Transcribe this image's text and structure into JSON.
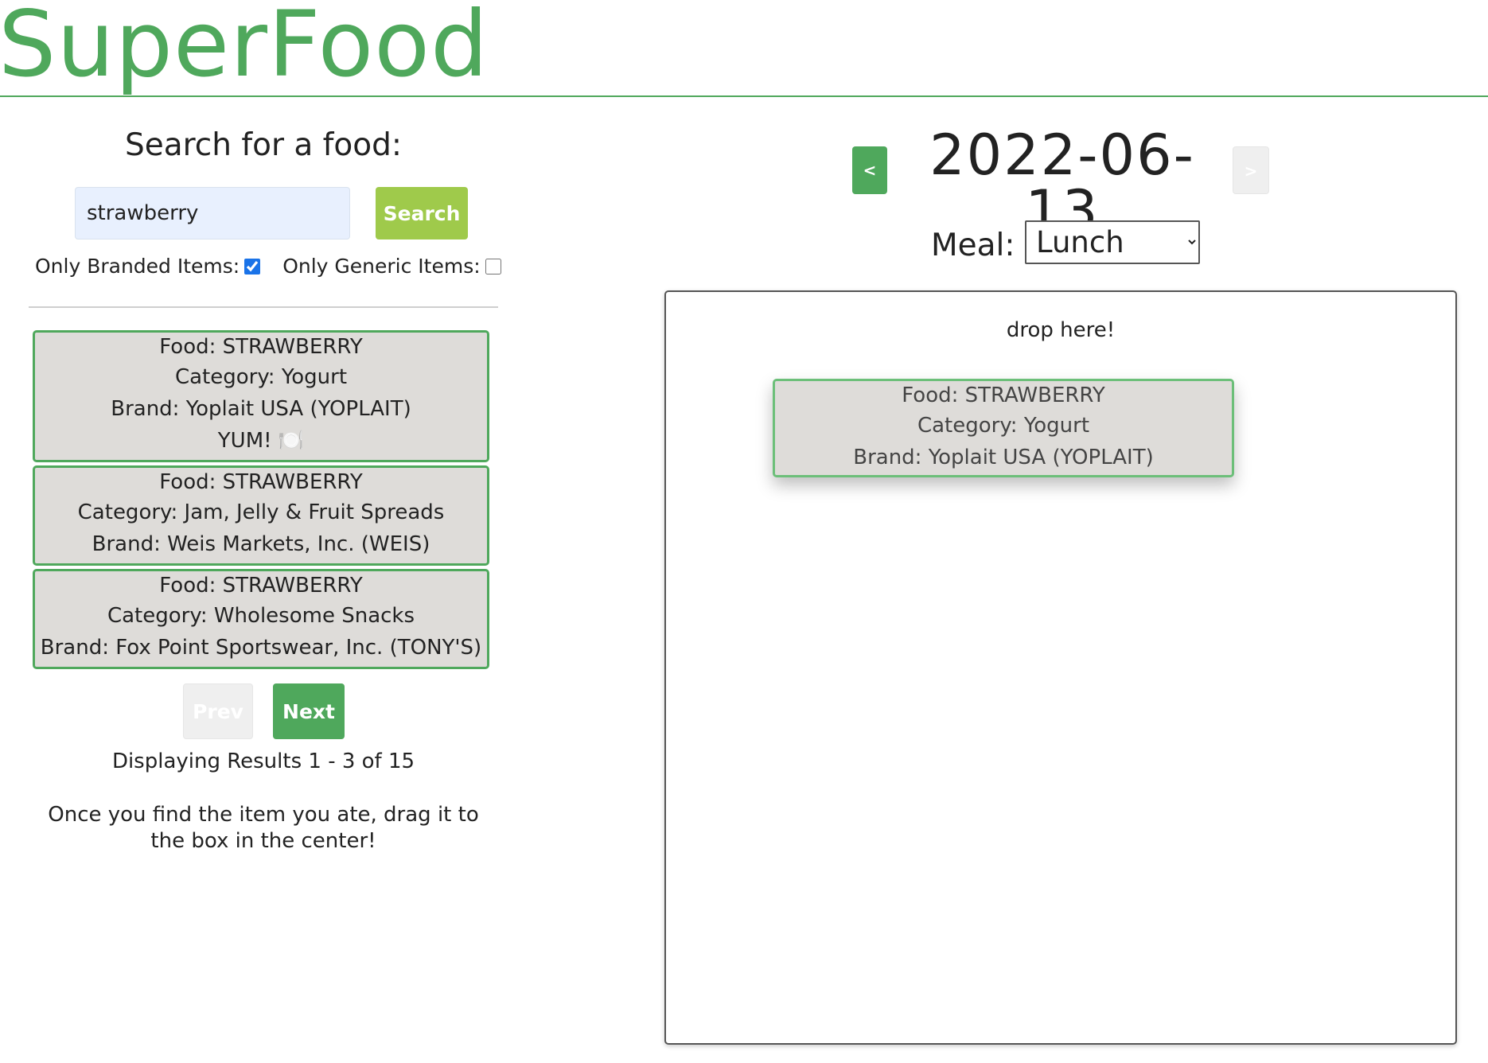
{
  "app": {
    "title": "SuperFood"
  },
  "search": {
    "heading": "Search for a food:",
    "input_value": "strawberry",
    "button_label": "Search",
    "filters": {
      "branded_label": "Only Branded Items:",
      "branded_checked": true,
      "generic_label": "Only Generic Items:",
      "generic_checked": false
    }
  },
  "results": [
    {
      "food": "Food: STRAWBERRY",
      "category": "Category: Yogurt",
      "brand": "Brand: Yoplait USA (YOPLAIT)",
      "note": "YUM! 🍽️"
    },
    {
      "food": "Food: STRAWBERRY",
      "category": "Category: Jam, Jelly & Fruit Spreads",
      "brand": "Brand: Weis Markets, Inc. (WEIS)"
    },
    {
      "food": "Food: STRAWBERRY",
      "category": "Category: Wholesome Snacks",
      "brand": "Brand: Fox Point Sportswear, Inc. (TONY'S)"
    }
  ],
  "pagination": {
    "prev_label": "Prev",
    "next_label": "Next",
    "summary": "Displaying Results 1 - 3 of 15"
  },
  "instructions": "Once you find the item you ate, drag it to the box in the center!",
  "diary": {
    "prev_day_label": "<",
    "next_day_label": ">",
    "date": "2022-06-13",
    "meal_label": "Meal:",
    "meal_selected": "Lunch",
    "drop_text": "drop here!",
    "dragged_item": {
      "food": "Food: STRAWBERRY",
      "category": "Category: Yogurt",
      "brand": "Brand: Yoplait USA (YOPLAIT)"
    }
  },
  "colors": {
    "brand_green": "#4fa85c",
    "search_green": "#9fca4b",
    "card_bg": "#dedcd9",
    "input_bg": "#e8f0fe"
  }
}
